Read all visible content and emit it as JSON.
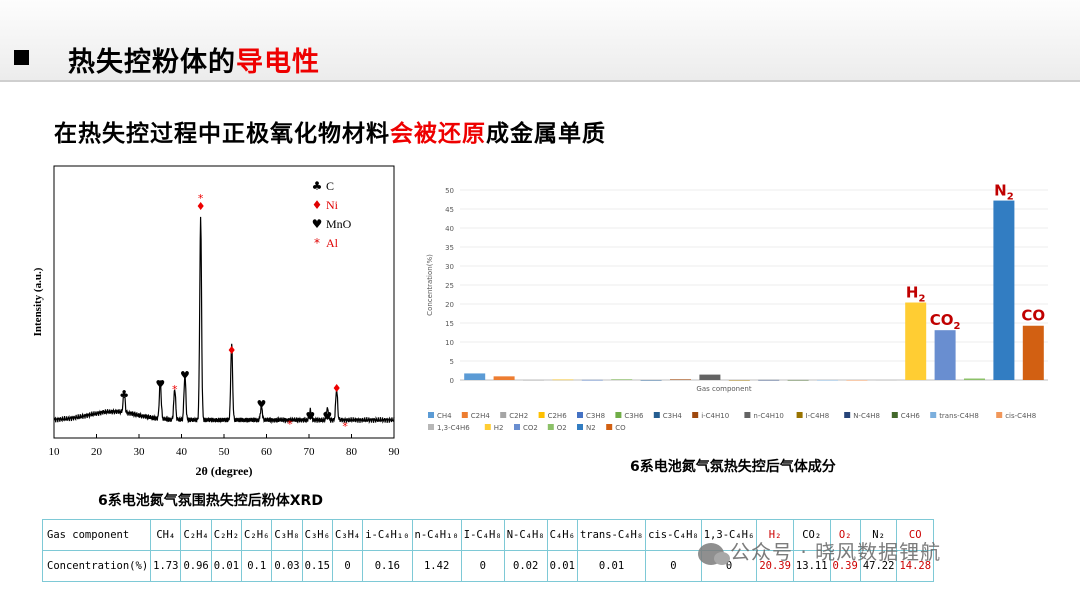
{
  "header": {
    "title_pre": "热失控粉体的",
    "title_highlight": "导电性"
  },
  "subtitle": {
    "pre": "在热失控过程中正极氧化物材料",
    "highlight": "会被还原",
    "post": "成金属单质"
  },
  "xrd": {
    "caption": "6系电池氮气氛围热失控后粉体XRD",
    "xlabel": "2θ (degree)",
    "ylabel": "Intensity (a.u.)",
    "xlim": [
      10,
      90
    ],
    "xticks": [
      "10",
      "20",
      "30",
      "40",
      "50",
      "60",
      "70",
      "80",
      "90"
    ],
    "legend": [
      {
        "symbol": "♣",
        "label": "C",
        "color": "#000000"
      },
      {
        "symbol": "♦",
        "label": "Ni",
        "color": "#e00000"
      },
      {
        "symbol": "♥",
        "label": "MnO",
        "color": "#000000"
      },
      {
        "symbol": "*",
        "label": "Al",
        "color": "#e00000"
      }
    ]
  },
  "chart_data": {
    "type": "bar",
    "title": "6系电池氮气氛热失控后气体成分",
    "xlabel": "Gas component",
    "ylabel": "Concentration(%)",
    "ylim": [
      0,
      50
    ],
    "yticks": [
      "0",
      "5",
      "10",
      "15",
      "20",
      "25",
      "30",
      "35",
      "40",
      "45",
      "50"
    ],
    "categories": [
      "CH4",
      "C2H4",
      "C2H2",
      "C2H6",
      "C3H8",
      "C3H6",
      "C3H4",
      "i-C4H10",
      "n-C4H10",
      "I-C4H8",
      "N-C4H8",
      "C4H6",
      "trans-C4H8",
      "cis-C4H8",
      "1,3-C4H6",
      "H2",
      "CO2",
      "O2",
      "N2",
      "CO"
    ],
    "values": [
      1.73,
      0.96,
      0.01,
      0.1,
      0.03,
      0.15,
      0,
      0.16,
      1.42,
      0,
      0.02,
      0.01,
      0.01,
      0,
      0,
      20.39,
      13.11,
      0.39,
      47.22,
      14.28
    ],
    "colors": [
      "#5b9bd5",
      "#ed7d31",
      "#a5a5a5",
      "#ffc000",
      "#4472c4",
      "#70ad47",
      "#255e91",
      "#9e480e",
      "#636363",
      "#997300",
      "#264478",
      "#43682b",
      "#7cafdd",
      "#f1975a",
      "#b7b7b7",
      "#ffcd33",
      "#698ed0",
      "#8cc168",
      "#327dc2",
      "#d26012"
    ],
    "annotations": [
      {
        "category": "H2",
        "base": "H",
        "sub": "2"
      },
      {
        "category": "CO2",
        "base": "CO",
        "sub": "2"
      },
      {
        "category": "N2",
        "base": "N",
        "sub": "2"
      },
      {
        "category": "CO",
        "base": "CO",
        "sub": ""
      }
    ]
  },
  "table": {
    "row1_header": "Gas component",
    "row2_header": "Concentration(%)",
    "columns": [
      {
        "label": "CH₄",
        "value": "1.73"
      },
      {
        "label": "C₂H₄",
        "value": "0.96"
      },
      {
        "label": "C₂H₂",
        "value": "0.01"
      },
      {
        "label": "C₂H₆",
        "value": "0.1"
      },
      {
        "label": "C₃H₈",
        "value": "0.03"
      },
      {
        "label": "C₃H₆",
        "value": "0.15"
      },
      {
        "label": "C₃H₄",
        "value": "0"
      },
      {
        "label": "i-C₄H₁₀",
        "value": "0.16"
      },
      {
        "label": "n-C₄H₁₀",
        "value": "1.42"
      },
      {
        "label": "I-C₄H₈",
        "value": "0"
      },
      {
        "label": "N-C₄H₈",
        "value": "0.02"
      },
      {
        "label": "C₄H₆",
        "value": "0.01"
      },
      {
        "label": "trans-C₄H₈",
        "value": "0.01"
      },
      {
        "label": "cis-C₄H₈",
        "value": "0"
      },
      {
        "label": "1,3-C₄H₆",
        "value": "0"
      },
      {
        "label": "H₂",
        "value": "20.39",
        "highlight": true
      },
      {
        "label": "CO₂",
        "value": "13.11"
      },
      {
        "label": "O₂",
        "value": "0.39",
        "highlight": true
      },
      {
        "label": "N₂",
        "value": "47.22"
      },
      {
        "label": "CO",
        "value": "14.28",
        "highlight": true
      }
    ]
  },
  "watermark": {
    "text": "公众号 · 晓风数据锂航"
  }
}
